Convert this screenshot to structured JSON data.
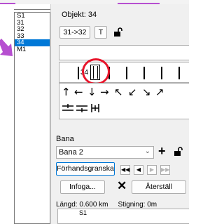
{
  "course_list": {
    "items": [
      "S1",
      "31",
      "32",
      "33",
      "34",
      "M1"
    ],
    "selected_index": 4
  },
  "object_panel": {
    "title": "Objekt: 34",
    "sequence_button": "31->32",
    "text_button": "T",
    "symbol_row_text": "34"
  },
  "bana_section": {
    "label": "Bana",
    "selected_course": "Bana 2",
    "preview_button": "Förhandsgranska",
    "insert_button": "Infoga...",
    "reset_button": "Återställ",
    "length_label": "Längd: 0.600 km",
    "climb_label": "Stigning: 0m",
    "bottom_list_first_item": "S1"
  },
  "colors": {
    "selection": "#0078d7",
    "highlight_circle": "#e8142a",
    "annotation_arrow": "#b64fd0"
  }
}
